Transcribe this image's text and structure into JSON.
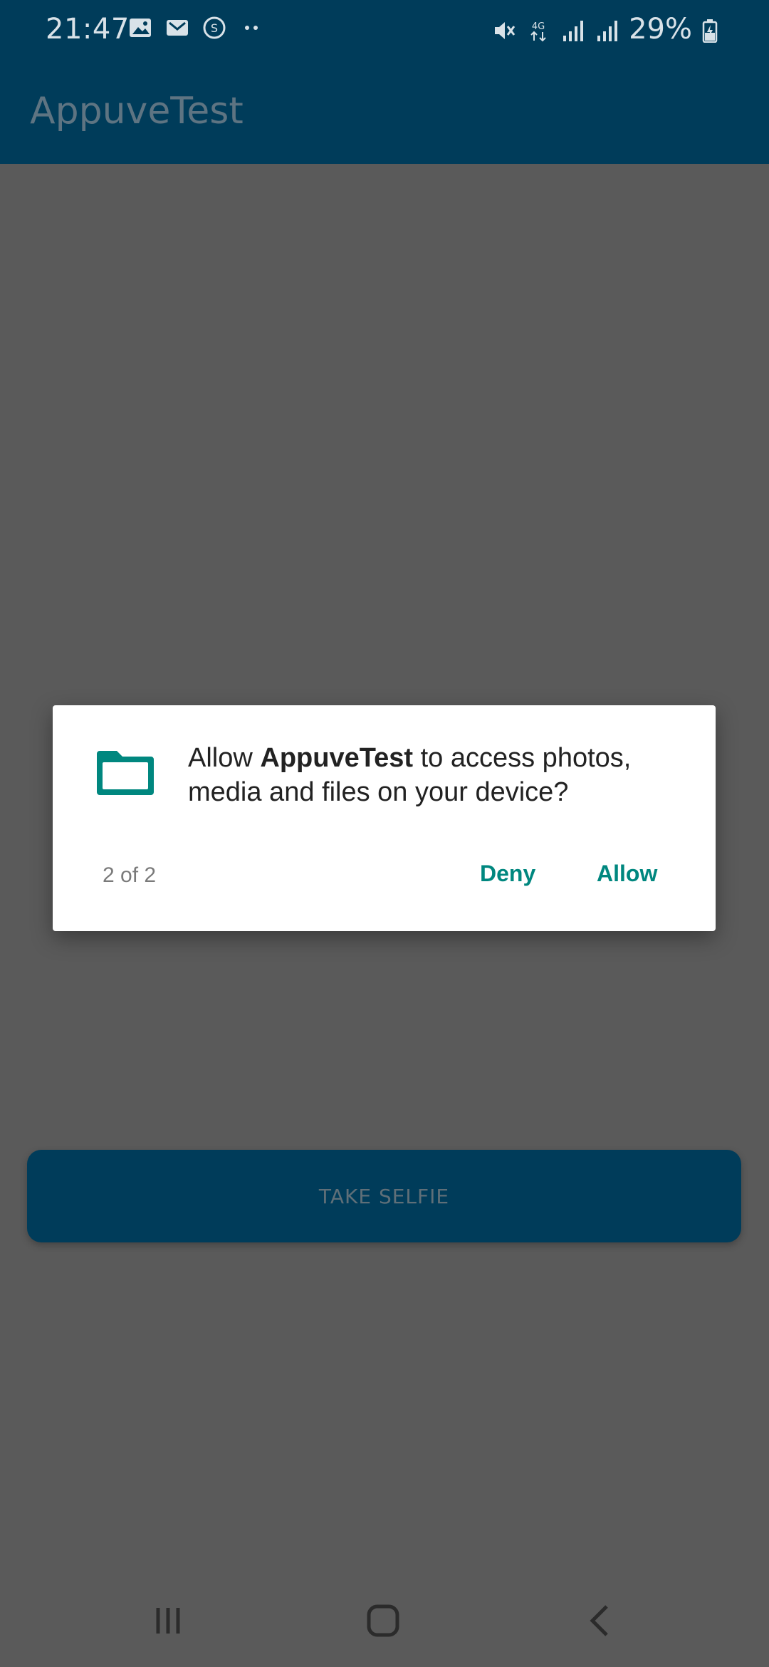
{
  "status_bar": {
    "time": "21:47",
    "battery": "29%",
    "left_icons": [
      "gallery-icon",
      "gmail-icon",
      "skype-icon",
      "more-dots-icon"
    ],
    "right_icons": [
      "mute-icon",
      "4g-data-icon",
      "signal-icon",
      "signal-icon",
      "battery-charging-icon"
    ]
  },
  "app_bar": {
    "title": "AppuveTest"
  },
  "main": {
    "take_selfie_label": "TAKE SELFIE"
  },
  "dialog": {
    "prefix": "Allow ",
    "app_name": "AppuveTest",
    "suffix": " to access photos, media and files on your device?",
    "counter": "2 of 2",
    "deny_label": "Deny",
    "allow_label": "Allow",
    "icon": "folder-icon",
    "accent_color": "#00877f"
  },
  "colors": {
    "primary": "#003c5a",
    "scrim_background": "#5a5a5a"
  },
  "nav_bar": {
    "icons": [
      "recent-apps-icon",
      "home-icon",
      "back-icon"
    ]
  }
}
